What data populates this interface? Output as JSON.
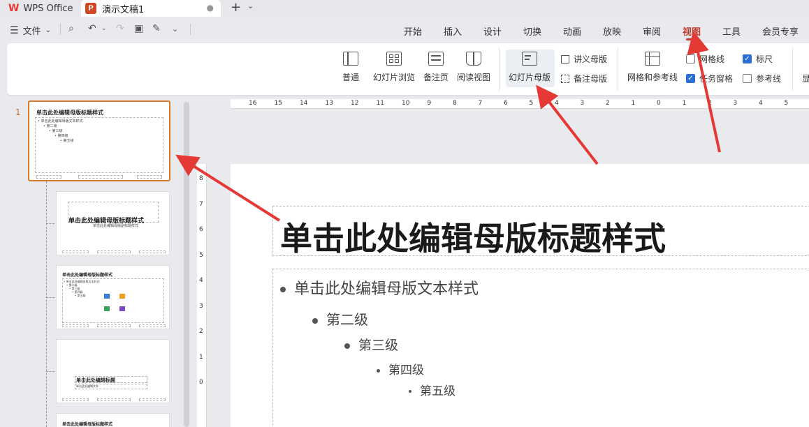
{
  "tabs": {
    "app": "WPS Office",
    "doc_icon": "P",
    "doc": "演示文稿1",
    "doc_dot": "●",
    "new_tab": "+",
    "new_tab_dropdown": "⌄"
  },
  "menubar": {
    "file": "文件",
    "file_caret": "⌄",
    "tabs": [
      "开始",
      "插入",
      "设计",
      "切换",
      "动画",
      "放映",
      "审阅",
      "视图",
      "工具",
      "会员专享"
    ],
    "active_tab": "视图"
  },
  "ribbon": {
    "normal": "普通",
    "slide_sorter": "幻灯片浏览",
    "notes_page": "备注页",
    "reading_view": "阅读视图",
    "slide_master": "幻灯片母版",
    "handout_master": "讲义母版",
    "notes_master": "备注母版",
    "grid_guides": "网格和参考线",
    "gridlines": "网格线",
    "gridlines_checked": false,
    "ruler": "标尺",
    "ruler_checked": true,
    "task_pane": "任务窗格",
    "task_pane_checked": true,
    "guides": "参考线",
    "guides_checked": false,
    "more": "显"
  },
  "ruler": {
    "h_ticks": [
      "16",
      "15",
      "14",
      "13",
      "12",
      "11",
      "10",
      "9",
      "8",
      "7",
      "6",
      "5",
      "4",
      "3",
      "2",
      "1",
      "0",
      "1",
      "2",
      "3",
      "4",
      "5"
    ],
    "v_ticks": [
      "8",
      "7",
      "6",
      "5",
      "4",
      "3",
      "2",
      "1",
      "0"
    ]
  },
  "thumbnails": {
    "slide_number": "1",
    "main_title": "单击此处编辑母版标题样式",
    "main_body": [
      "• 单击此处编辑母版文本样式",
      "• 第二级",
      "• 第三级",
      "• 第四级",
      "• 第五级"
    ],
    "layout1_title": "单击此处编辑母版标题样式",
    "layout1_subtitle": "单击此处编辑母版副标题样式",
    "layout2_title": "单击此处编辑母版标题样式",
    "layout2_body": [
      "• 单击此处编辑母版文本样式",
      "• 第二级",
      "• 第三级",
      "• 第四级",
      "• 第五级"
    ],
    "layout3_title": "单击此处编辑标题",
    "layout3_body": "单击此处编辑文本",
    "layout4_title": "单击此处编辑母版标题样式"
  },
  "slide": {
    "title": "单击此处编辑母版标题样式",
    "levels": [
      "单击此处编辑母版文本样式",
      "第二级",
      "第三级",
      "第四级",
      "第五级"
    ]
  },
  "colors": {
    "accent": "#c0392b",
    "annotation_arrow": "#e53935",
    "selected_thumb": "#d97a2c",
    "checkbox": "#2b6fd6"
  }
}
